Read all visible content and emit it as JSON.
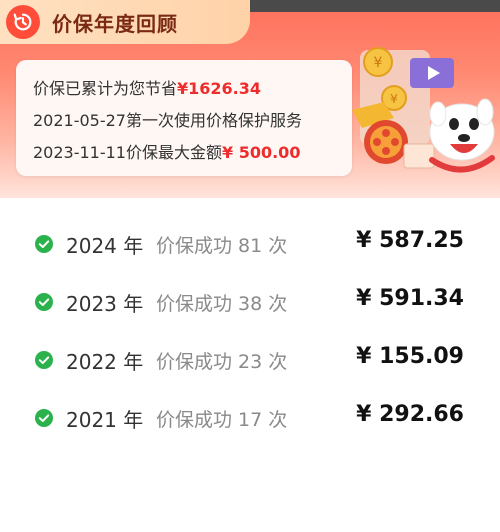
{
  "header": {
    "title": "价保年度回顾"
  },
  "summary": {
    "saved_prefix": "价保已累计为您节省",
    "saved_amount": "¥1626.34",
    "first_use_date": "2021-05-27",
    "first_use_text": "第一次使用价格保护服务",
    "max_date": "2023-11-11",
    "max_text": "价保最大金额",
    "max_amount": "¥ 500.00"
  },
  "years": [
    {
      "year": "2024 年",
      "desc": "价保成功 81 次",
      "amount": "¥ 587.25"
    },
    {
      "year": "2023 年",
      "desc": "价保成功 38 次",
      "amount": "¥ 591.34"
    },
    {
      "year": "2022 年",
      "desc": "价保成功 23 次",
      "amount": "¥ 155.09"
    },
    {
      "year": "2021 年",
      "desc": "价保成功 17 次",
      "amount": "¥ 292.66"
    }
  ],
  "colors": {
    "accent_red": "#ee2c2c",
    "check_green": "#2bb24c",
    "header_gradient_top": "#ff6f5a"
  },
  "icons": {
    "title_icon": "history-clock-icon",
    "row_icon": "check-circle-icon",
    "illustration": "mascot-coins-illustration"
  }
}
